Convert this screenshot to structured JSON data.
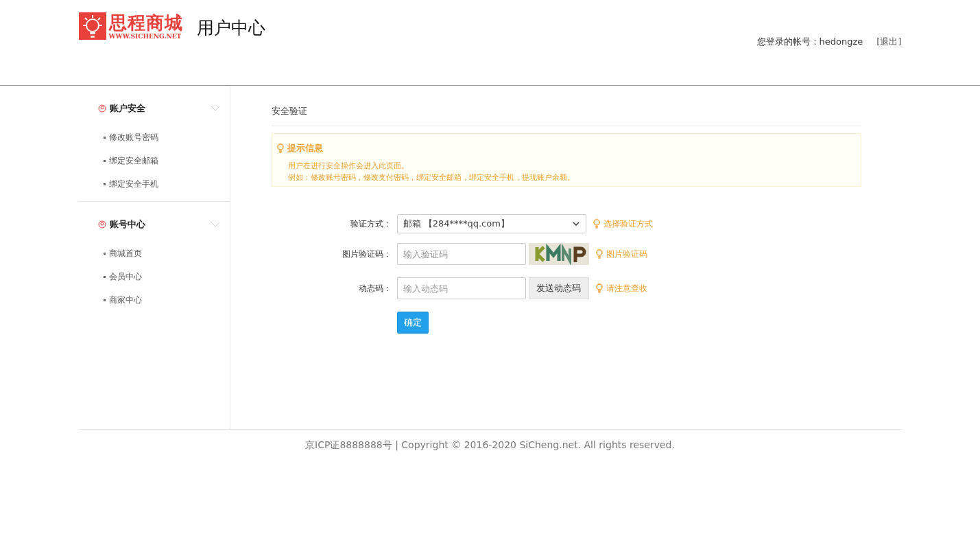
{
  "header": {
    "logo_name": "思程商城",
    "logo_url": "WWW.SICHENG.NET",
    "title": "用户中心",
    "account_label": "您登录的帐号：hedongze",
    "logout": "[退出]"
  },
  "sidebar": {
    "groups": [
      {
        "title": "账户安全",
        "expanded": true,
        "items": [
          "修改账号密码",
          "绑定安全邮箱",
          "绑定安全手机"
        ]
      },
      {
        "title": "账号中心",
        "expanded": true,
        "items": [
          "商城首页",
          "会员中心",
          "商家中心"
        ]
      }
    ]
  },
  "main": {
    "title": "安全验证",
    "notice": {
      "title": "提示信息",
      "lines": [
        "用户在进行安全操作会进入此页面。",
        "例如：修改账号密码，修改支付密码，绑定安全邮箱，绑定安全手机，提现账户余额。"
      ]
    },
    "form": {
      "rows": [
        {
          "kind": "select",
          "label": "验证方式：",
          "value": "邮箱 【284****qq.com】",
          "hint": "选择验证方式"
        },
        {
          "kind": "captcha",
          "label": "图片验证码：",
          "placeholder": "输入验证码",
          "hint": "图片验证码"
        },
        {
          "kind": "code",
          "label": "动态码：",
          "placeholder": "输入动态码",
          "button": "发送动态码",
          "hint": "请注意查收"
        }
      ],
      "submit": "确定"
    }
  },
  "footer": {
    "text": "京ICP证8888888号 | Copyright © 2016-2020 SiCheng.net. All rights reserved."
  }
}
